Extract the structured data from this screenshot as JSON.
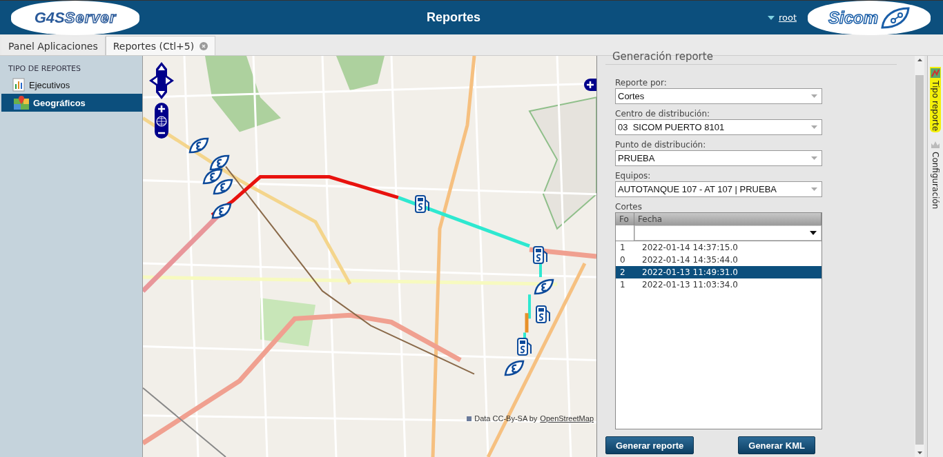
{
  "header": {
    "title": "Reportes",
    "logo_left": {
      "part_1": "G4S",
      "part_2": "Server"
    },
    "user": "root",
    "logo_right": "Sicom"
  },
  "tabs": [
    {
      "label": "Panel Aplicaciones",
      "selected": false,
      "closable": false
    },
    {
      "label": "Reportes (Ctl+5)",
      "selected": true,
      "closable": true
    }
  ],
  "sidebar": {
    "heading": "TIPO DE REPORTES",
    "items": [
      {
        "label": "Ejecutivos",
        "kind": "chart",
        "selected": false
      },
      {
        "label": "Geográficos",
        "kind": "map",
        "selected": true
      }
    ]
  },
  "map": {
    "attribution": "Data CC-By-SA by",
    "attribution_link": "OpenStreetMap"
  },
  "panel": {
    "title": "Generación reporte",
    "fields": [
      {
        "label": "Reporte por:",
        "value": "Cortes"
      },
      {
        "label": "Centro de distribución:",
        "value": "03  SICOM PUERTO 8101"
      },
      {
        "label": "Punto de distribución:",
        "value": "PRUEBA"
      },
      {
        "label": "Equipos:",
        "value": "AUTOTANQUE 107 - AT 107 | PRUEBA"
      }
    ],
    "grid": {
      "label": "Cortes",
      "columns": [
        "Fo",
        "Fecha"
      ],
      "rows": [
        {
          "fo": "1",
          "fecha": "2022-01-14 14:37:15.0",
          "selected": false
        },
        {
          "fo": "0",
          "fecha": "2022-01-14 14:35:44.0",
          "selected": false
        },
        {
          "fo": "2",
          "fecha": "2022-01-13 11:49:31.0",
          "selected": true
        },
        {
          "fo": "1",
          "fecha": "2022-01-13 11:03:34.0",
          "selected": false
        }
      ]
    },
    "buttons": [
      "Generar reporte",
      "Generar KML"
    ]
  },
  "side_tabs": [
    {
      "label": "Tipo reporte",
      "selected": true,
      "kind": "report"
    },
    {
      "label": "Configuración",
      "selected": false,
      "kind": "config"
    }
  ]
}
